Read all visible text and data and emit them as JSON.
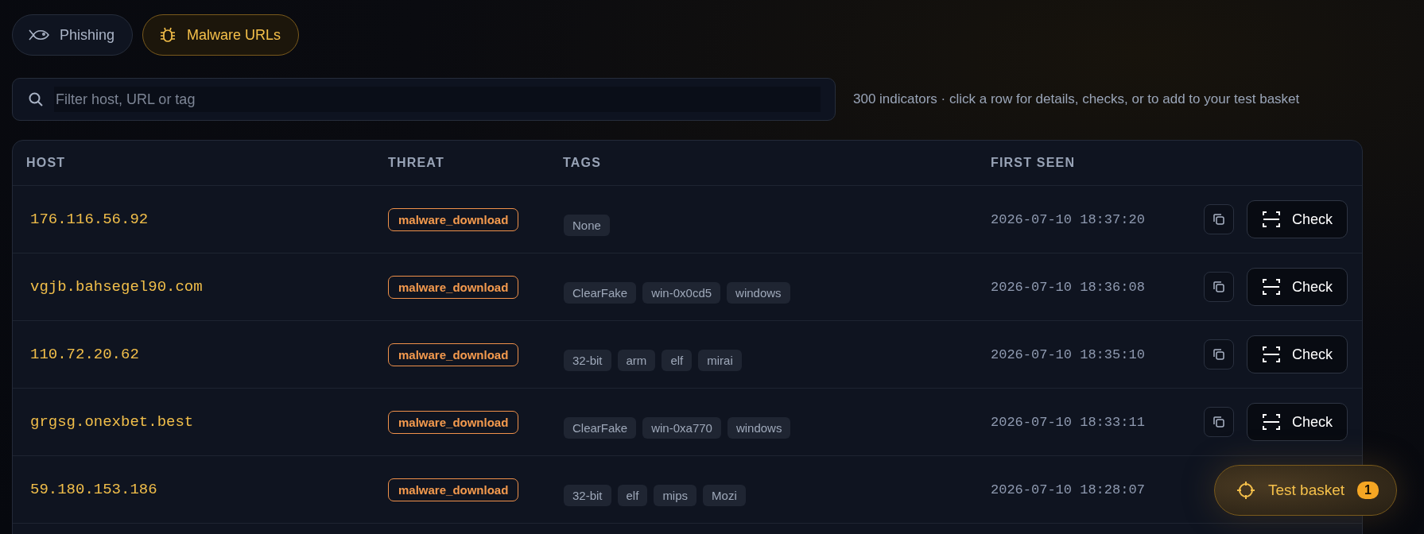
{
  "tabs": [
    {
      "label": "Phishing",
      "selected": false
    },
    {
      "label": "Malware URLs",
      "selected": true
    }
  ],
  "search": {
    "placeholder": "Filter host, URL or tag"
  },
  "info": "300 indicators · click a row for details, checks, or to add to your test basket",
  "table": {
    "columns": [
      "HOST",
      "THREAT",
      "TAGS",
      "FIRST SEEN"
    ],
    "rows": [
      {
        "host": "176.116.56.92",
        "threat": "malware_download",
        "tags": [
          "None"
        ],
        "first_seen": "2026-07-10 18:37:20",
        "action": "Check"
      },
      {
        "host": "vgjb.bahsegel90.com",
        "threat": "malware_download",
        "tags": [
          "ClearFake",
          "win-0x0cd5",
          "windows"
        ],
        "first_seen": "2026-07-10 18:36:08",
        "action": "Check"
      },
      {
        "host": "110.72.20.62",
        "threat": "malware_download",
        "tags": [
          "32-bit",
          "arm",
          "elf",
          "mirai"
        ],
        "first_seen": "2026-07-10 18:35:10",
        "action": "Check"
      },
      {
        "host": "grgsg.onexbet.best",
        "threat": "malware_download",
        "tags": [
          "ClearFake",
          "win-0xa770",
          "windows"
        ],
        "first_seen": "2026-07-10 18:33:11",
        "action": "Check"
      },
      {
        "host": "59.180.153.186",
        "threat": "malware_download",
        "tags": [
          "32-bit",
          "elf",
          "mips",
          "Mozi"
        ],
        "first_seen": "2026-07-10 18:28:07"
      }
    ]
  },
  "basket": {
    "label": "Test basket",
    "count": "1"
  }
}
